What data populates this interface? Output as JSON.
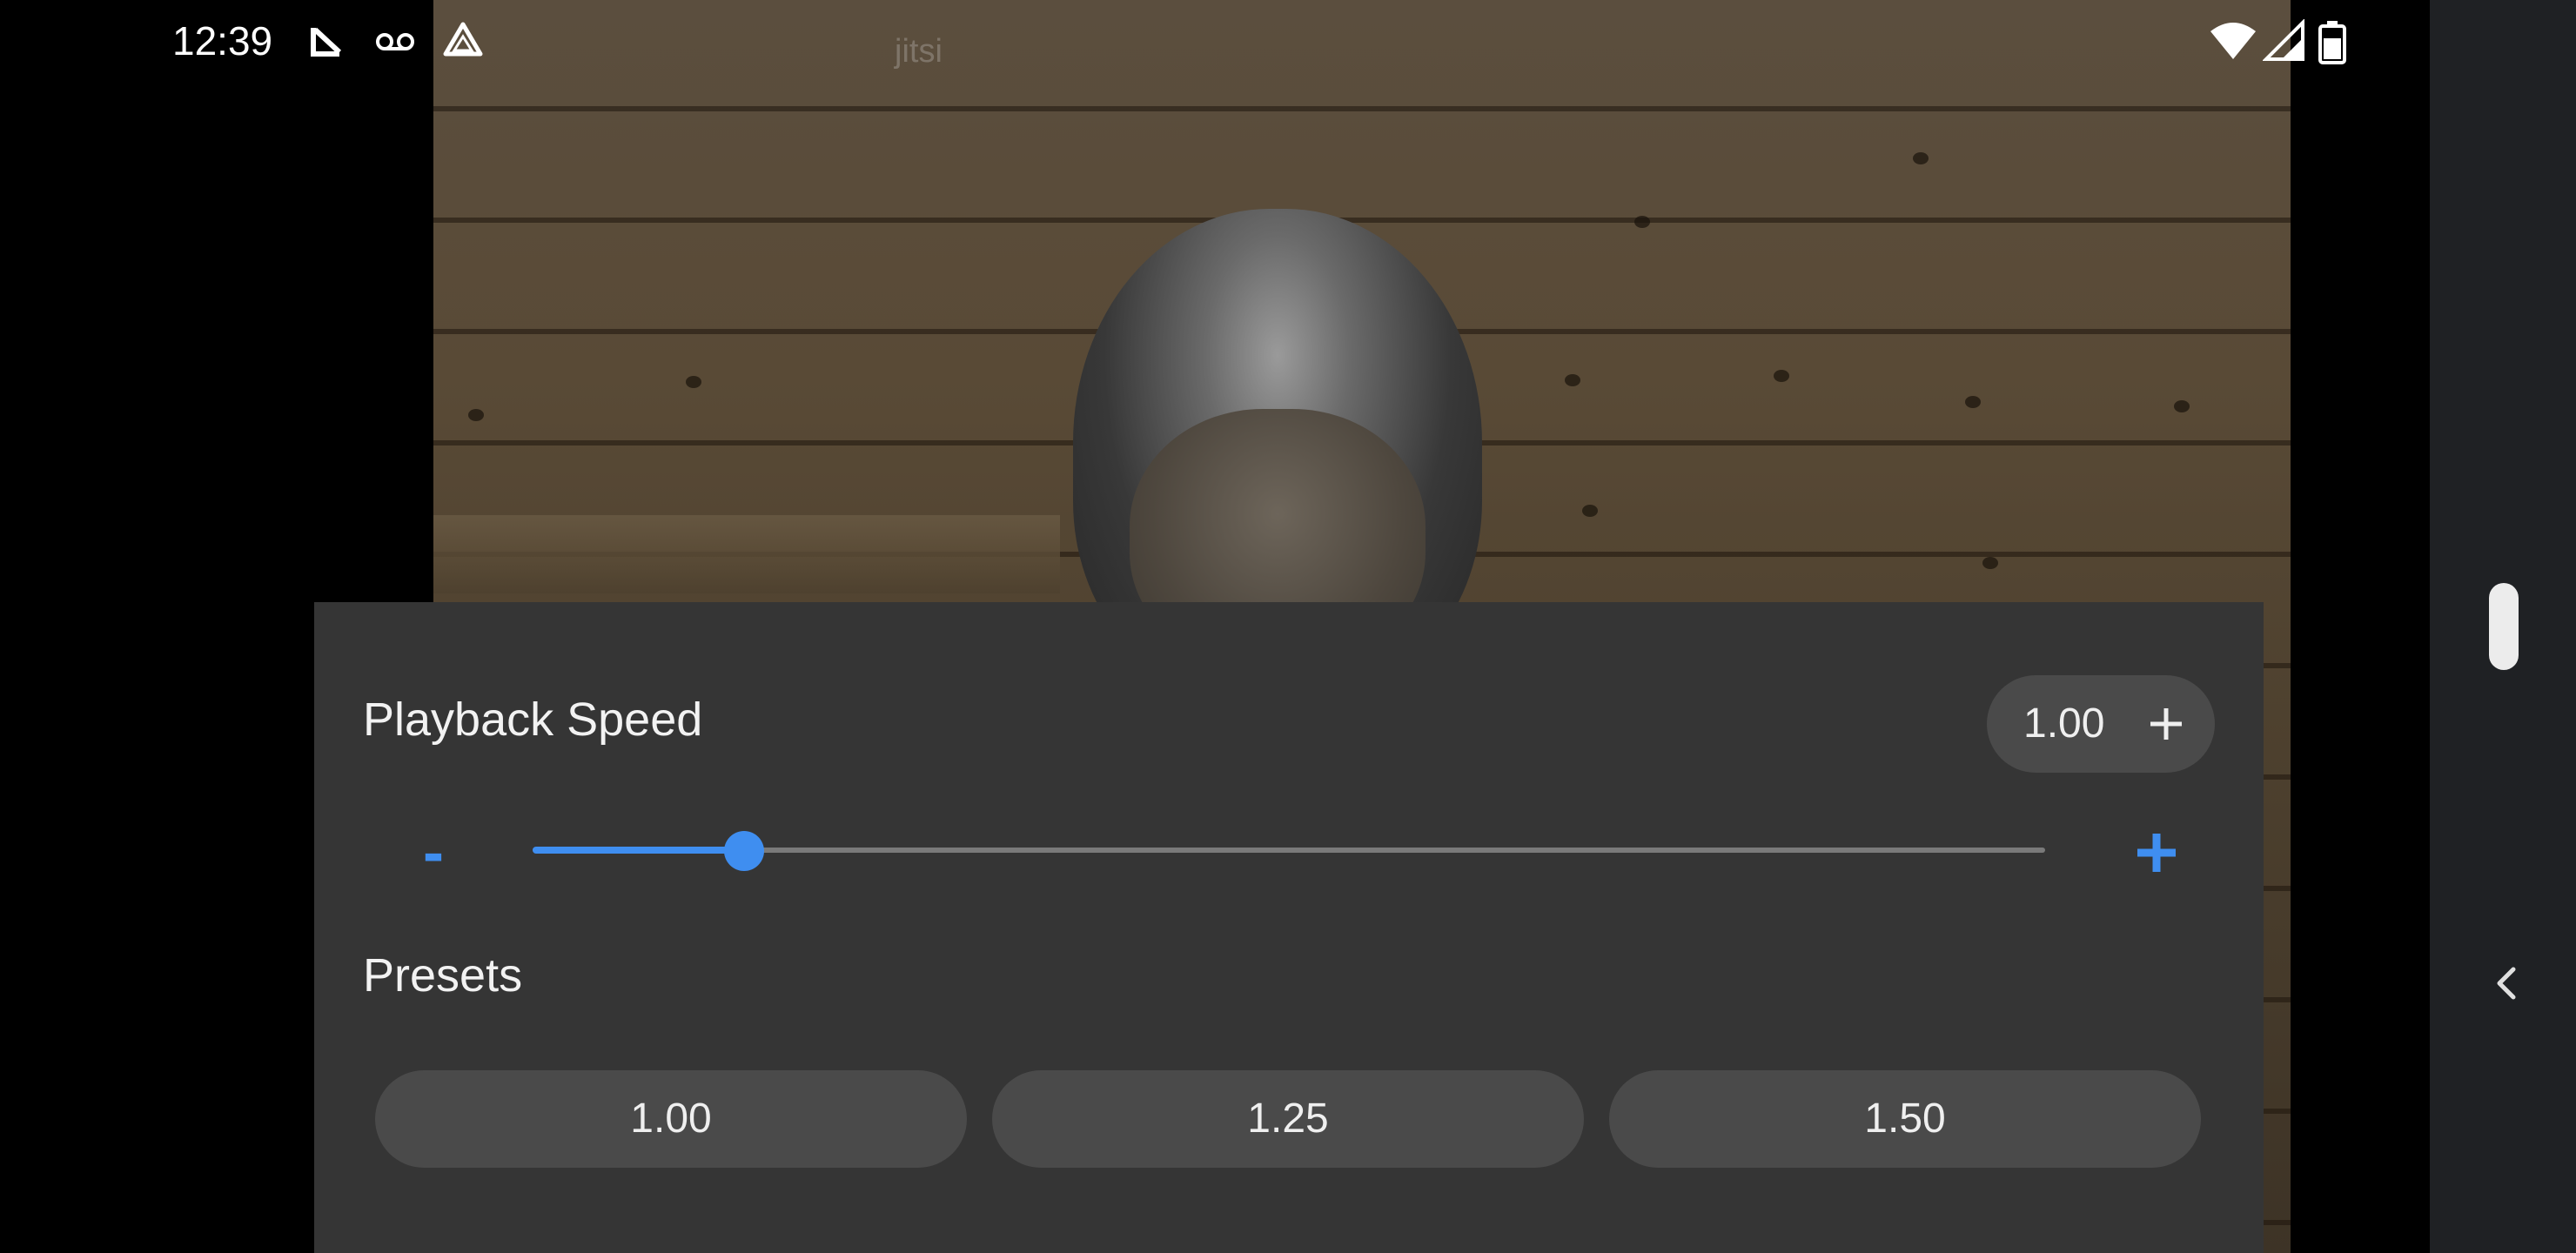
{
  "status_bar": {
    "time": "12:39",
    "left_icons": [
      "missed-call-icon",
      "voicemail-icon",
      "drive-icon"
    ],
    "right_icons": [
      "wifi-icon",
      "cell-signal-icon",
      "battery-icon"
    ]
  },
  "video": {
    "watermark": "jitsi"
  },
  "playback": {
    "title": "Playback Speed",
    "current_value": "1.00",
    "slider_fraction": 0.14,
    "accent_color": "#3f8ef0",
    "decrement_label": "-"
  },
  "presets": {
    "title": "Presets",
    "options": [
      "1.00",
      "1.25",
      "1.50"
    ]
  },
  "system_nav": {
    "icons": [
      "scroll-handle",
      "back-chevron-icon"
    ]
  }
}
